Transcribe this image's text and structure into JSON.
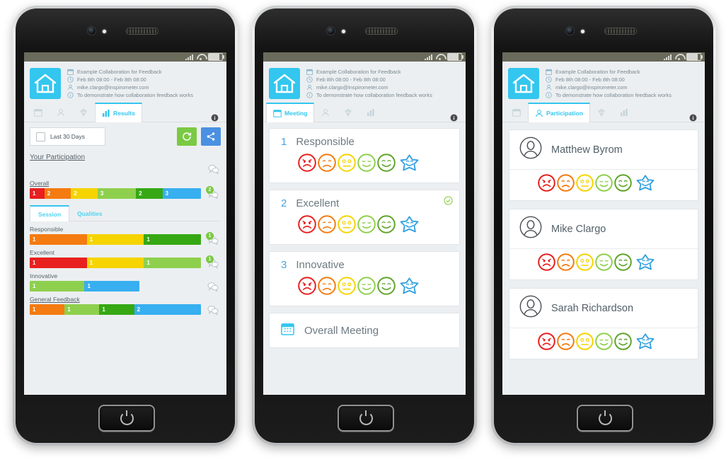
{
  "meeting": {
    "title": "Example Collaboration for Feedback",
    "time": "Feb 8th 08:00 - Feb 8th 08:00",
    "email": "mike.clargo@inspirometer.com",
    "purpose": "To demonstrate how collaboration feedback works"
  },
  "icons": {
    "calendar": "calendar-icon",
    "clock": "clock-icon",
    "person": "person-icon",
    "info": "info-icon",
    "diamond": "diamond-icon",
    "chart": "bar-chart-icon",
    "refresh": "refresh-icon",
    "share": "share-icon",
    "comment": "comment-bubble-icon",
    "check": "check-circle-icon",
    "home": "home-icon"
  },
  "phone1": {
    "tabs": [
      {
        "label": "",
        "icon": "calendar-icon",
        "active": false
      },
      {
        "label": "",
        "icon": "person-icon",
        "active": false
      },
      {
        "label": "",
        "icon": "diamond-icon",
        "active": false
      },
      {
        "label": "Results",
        "icon": "bar-chart-icon",
        "active": true
      }
    ],
    "info_tab": "info-icon",
    "date_filter": "Last 30 Days",
    "refresh_label": "refresh-icon",
    "share_label": "share-icon",
    "participation_link": "Your Participation",
    "overall_label": "Overall",
    "general_feedback_label": "General Feedback",
    "subtabs": [
      {
        "label": "Session",
        "active": true
      },
      {
        "label": "Qualities",
        "active": false
      }
    ],
    "overall_bar": {
      "comments": 2,
      "segments": [
        {
          "value": "1",
          "color": "#e8201f",
          "weight": 1
        },
        {
          "value": "2",
          "color": "#f47b10",
          "weight": 2
        },
        {
          "value": "2",
          "color": "#f5d400",
          "weight": 2
        },
        {
          "value": "3",
          "color": "#8ed04e",
          "weight": 3
        },
        {
          "value": "2",
          "color": "#36a814",
          "weight": 2
        },
        {
          "value": "3",
          "color": "#37aff0",
          "weight": 3
        }
      ]
    },
    "qualities": [
      {
        "label": "Responsible",
        "comments": 1,
        "segments": [
          {
            "value": "1",
            "color": "#f47b10",
            "weight": 1
          },
          {
            "value": "1",
            "color": "#f5d400",
            "weight": 1
          },
          {
            "value": "1",
            "color": "#36a814",
            "weight": 1
          }
        ]
      },
      {
        "label": "Excellent",
        "comments": 1,
        "segments": [
          {
            "value": "1",
            "color": "#e8201f",
            "weight": 1
          },
          {
            "value": "1",
            "color": "#f5d400",
            "weight": 1
          },
          {
            "value": "1",
            "color": "#8ed04e",
            "weight": 1
          }
        ]
      },
      {
        "label": "Innovative",
        "comments": 0,
        "segments": [
          {
            "value": "1",
            "color": "#8ed04e",
            "weight": 1
          },
          {
            "value": "1",
            "color": "#37aff0",
            "weight": 1
          }
        ]
      }
    ],
    "general_bar": {
      "comments": 0,
      "segments": [
        {
          "value": "1",
          "color": "#f47b10",
          "weight": 1
        },
        {
          "value": "1",
          "color": "#8ed04e",
          "weight": 1
        },
        {
          "value": "1",
          "color": "#36a814",
          "weight": 1
        },
        {
          "value": "2",
          "color": "#37aff0",
          "weight": 2
        }
      ]
    }
  },
  "phone2": {
    "tabs": [
      {
        "label": "Meeting",
        "icon": "calendar-icon",
        "active": true
      },
      {
        "label": "",
        "icon": "person-icon",
        "active": false
      },
      {
        "label": "",
        "icon": "diamond-icon",
        "active": false
      },
      {
        "label": "",
        "icon": "bar-chart-icon",
        "active": false
      }
    ],
    "info_tab": "info-icon",
    "questions": [
      {
        "num": "1",
        "text": "Responsible",
        "answered": false
      },
      {
        "num": "2",
        "text": "Excellent",
        "answered": true
      },
      {
        "num": "3",
        "text": "Innovative",
        "answered": false
      }
    ],
    "overall_card": "Overall Meeting"
  },
  "phone3": {
    "tabs": [
      {
        "label": "",
        "icon": "calendar-icon",
        "active": false
      },
      {
        "label": "Participation",
        "icon": "person-icon",
        "active": true
      },
      {
        "label": "",
        "icon": "diamond-icon",
        "active": false
      },
      {
        "label": "",
        "icon": "bar-chart-icon",
        "active": false
      }
    ],
    "info_tab": "info-icon",
    "participants": [
      {
        "name": "Matthew Byrom"
      },
      {
        "name": "Mike Clargo"
      },
      {
        "name": "Sarah Richardson"
      }
    ]
  },
  "rating_faces": [
    {
      "name": "angry-face",
      "color": "#e8201f"
    },
    {
      "name": "sad-face",
      "color": "#f47b10"
    },
    {
      "name": "neutral-face",
      "color": "#f5d400"
    },
    {
      "name": "content-face",
      "color": "#8ed04e"
    },
    {
      "name": "happy-face",
      "color": "#5fa52a"
    },
    {
      "name": "star-face",
      "color": "#2f9fe0"
    }
  ],
  "colors": {
    "accent": "#33c6ef",
    "green": "#7ac943",
    "blue": "#4a90e2",
    "screen_bg": "#eceff1"
  }
}
